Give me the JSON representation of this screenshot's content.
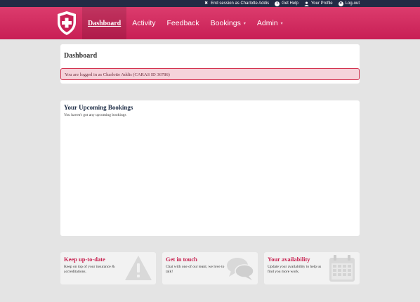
{
  "topbar": {
    "links": [
      {
        "label": "End session as Charlotte Addis",
        "icon": "close-icon"
      },
      {
        "label": "Get Help",
        "icon": "info-icon"
      },
      {
        "label": "Your Profile",
        "icon": "user-icon"
      },
      {
        "label": "Log-out",
        "icon": "logout-icon"
      }
    ]
  },
  "nav": {
    "logo_icon": "shield-cross-icon",
    "items": [
      {
        "label": "Dashboard",
        "active": true
      },
      {
        "label": "Activity"
      },
      {
        "label": "Feedback"
      },
      {
        "label": "Bookings",
        "dropdown": true
      },
      {
        "label": "Admin",
        "dropdown": true
      }
    ],
    "dropdown_glyph": "▾"
  },
  "dashboard": {
    "title": "Dashboard",
    "alert": "You are logged in as Charlotte Addis (CARAS ID 36786)"
  },
  "bookings": {
    "title": "Your Upcoming Bookings",
    "empty_text": "You haven't got any upcoming bookings"
  },
  "cards": [
    {
      "title": "Keep up-to-date",
      "text": "Keep on top of your insurance & accreditations.",
      "icon": "warning-icon"
    },
    {
      "title": "Get in touch",
      "text": "Chat with one of our team; we love to talk!",
      "icon": "chat-bubbles-icon"
    },
    {
      "title": "Your availability",
      "text": "Update your availability to help us find you more work.",
      "icon": "calendar-icon"
    }
  ],
  "colors": {
    "brand": "#c81f55",
    "topbar": "#232b45",
    "alert_bg": "#f5d2da",
    "alert_border": "#d3324f"
  }
}
